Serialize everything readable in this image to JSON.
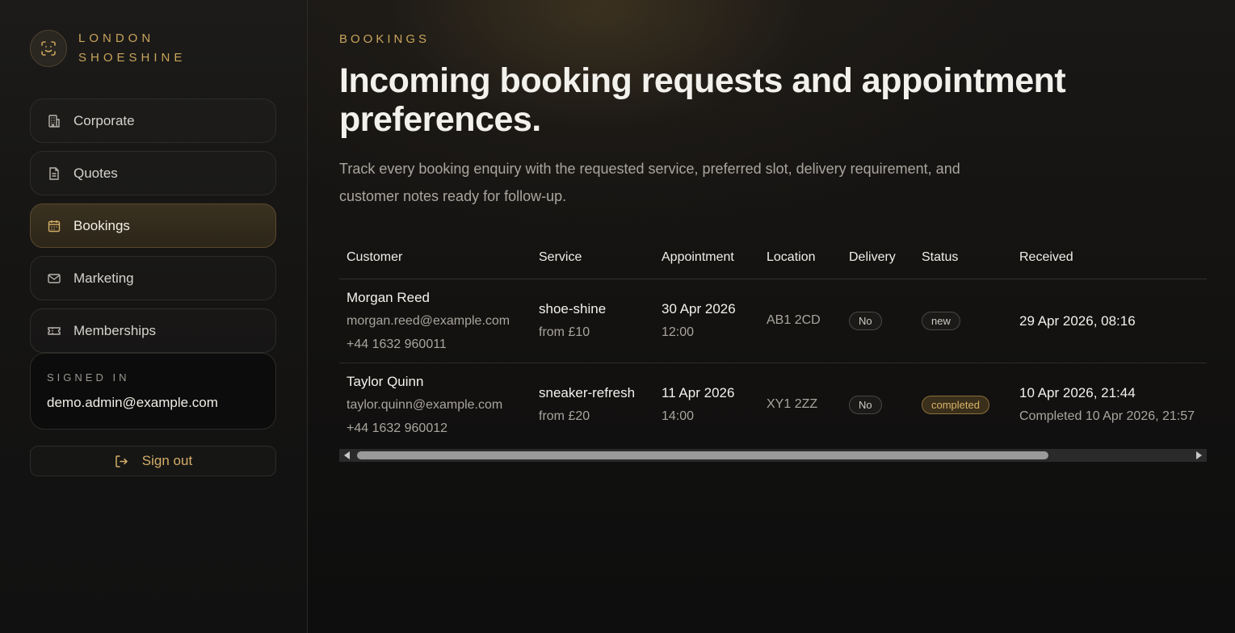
{
  "brand": {
    "line1": "LONDON",
    "line2": "SHOESHINE",
    "icon": "scan-face-icon"
  },
  "sidebar": {
    "items": [
      {
        "label": "Corporate",
        "icon": "building-icon",
        "active": false
      },
      {
        "label": "Quotes",
        "icon": "document-icon",
        "active": false
      },
      {
        "label": "Bookings",
        "icon": "calendar-icon",
        "active": true
      },
      {
        "label": "Marketing",
        "icon": "mail-icon",
        "active": false
      },
      {
        "label": "Memberships",
        "icon": "ticket-icon",
        "active": false
      }
    ],
    "signed_in_label": "SIGNED IN",
    "signed_in_email": "demo.admin@example.com",
    "sign_out_label": "Sign out"
  },
  "page": {
    "eyebrow": "BOOKINGS",
    "title": "Incoming booking requests and appointment preferences.",
    "subtitle": "Track every booking enquiry with the requested service, preferred slot, delivery requirement, and customer notes ready for follow-up."
  },
  "table": {
    "columns": [
      "Customer",
      "Service",
      "Appointment",
      "Location",
      "Delivery",
      "Status",
      "Received"
    ],
    "rows": [
      {
        "name": "Morgan Reed",
        "email": "morgan.reed@example.com",
        "phone": "+44 1632 960011",
        "service": "shoe-shine",
        "price": "from £10",
        "date": "30 Apr 2026",
        "time": "12:00",
        "location": "AB1 2CD",
        "delivery": "No",
        "status": "new",
        "received": "29 Apr 2026, 08:16",
        "received_note": ""
      },
      {
        "name": "Taylor Quinn",
        "email": "taylor.quinn@example.com",
        "phone": "+44 1632 960012",
        "service": "sneaker-refresh",
        "price": "from £20",
        "date": "11 Apr 2026",
        "time": "14:00",
        "location": "XY1 2ZZ",
        "delivery": "No",
        "status": "completed",
        "received": "10 Apr 2026, 21:44",
        "received_note": "Completed 10 Apr 2026, 21:57"
      }
    ]
  },
  "colors": {
    "accent": "#c9a45c",
    "background": "#0f0f0f",
    "text": "#f3f1ec",
    "muted": "#a9a59e"
  }
}
